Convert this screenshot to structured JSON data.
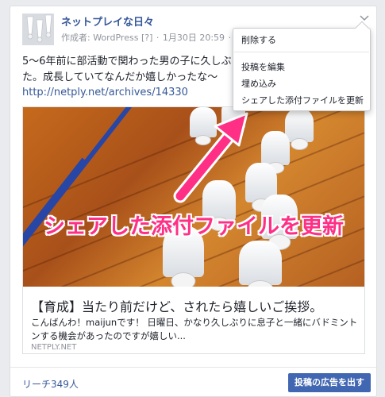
{
  "post": {
    "page_name": "ネットプレイな日々",
    "byline": {
      "author_prefix": "作成者: WordPress",
      "help": "[?]",
      "date": "1月30日 20:59",
      "dot": "·",
      "audience_icon": "globe-icon"
    },
    "text": "5〜6年前に部活動で関わった男の子に久しぶり した。成長していてなんだか嬉しかったな〜",
    "link": "http://netply.net/archives/14330"
  },
  "link_preview": {
    "overlay_text": "シェアした添付ファイルを更新",
    "title": "【育成】当たり前だけど、されたら嬉しいご挨拶。",
    "description": "こんばんわ！maijunです！ 日曜日、かなり久しぶりに息子と一緒にバドミントンする機会があったのですが嬉しい...",
    "domain": "NETPLY.NET"
  },
  "dropdown": {
    "items": [
      {
        "label": "削除する"
      },
      {
        "label": "投稿を編集"
      },
      {
        "label": "埋め込み"
      },
      {
        "label": "シェアした添付ファイルを更新"
      }
    ]
  },
  "footer": {
    "reach": "リーチ349人",
    "boost_button": "投稿の広告を出す"
  },
  "colors": {
    "link": "#365899",
    "button": "#4267b2",
    "overlay_text": "#ff2f86",
    "arrow": "#ff2f86"
  }
}
